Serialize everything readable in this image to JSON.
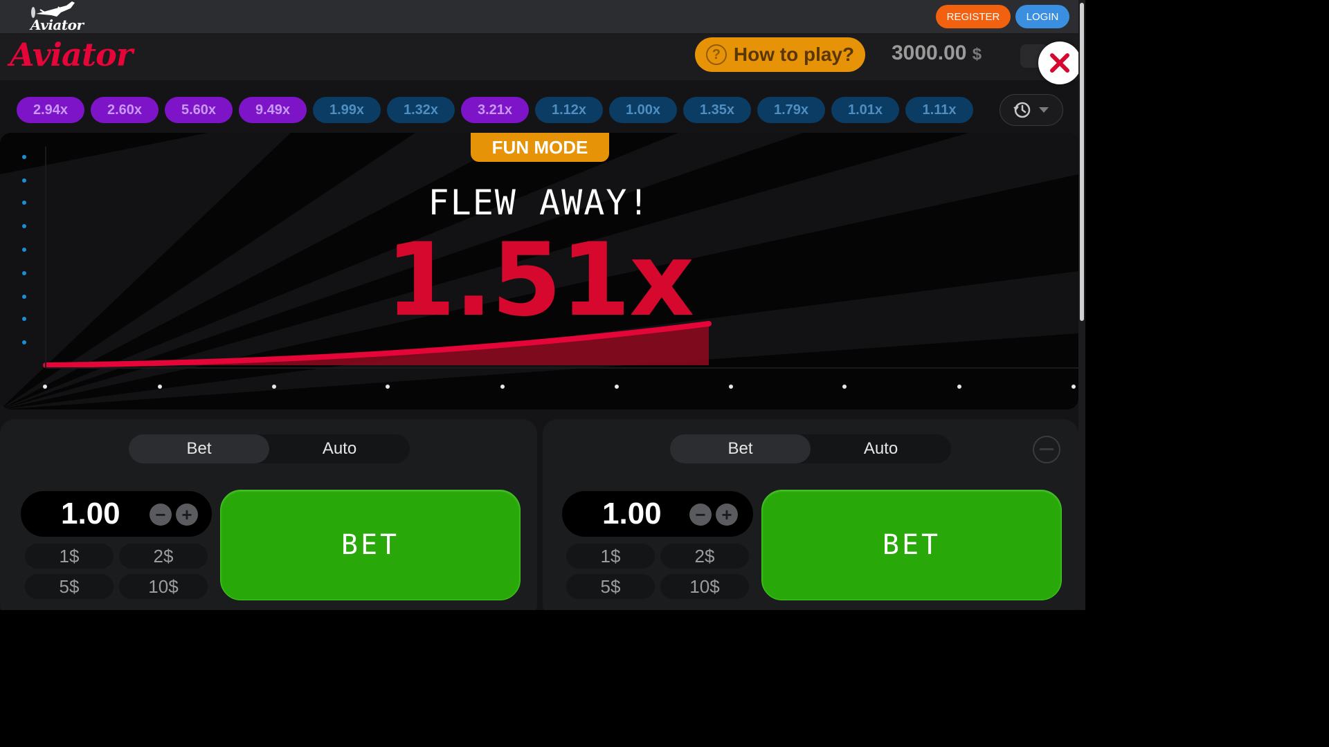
{
  "site_header": {
    "logo_text": "Aviator",
    "register_label": "REGISTER",
    "login_label": "LOGIN",
    "colors": {
      "register": "#f2610f",
      "login": "#3b8fe0"
    }
  },
  "game": {
    "title": "Aviator",
    "how_to_play_label": "How to play?",
    "balance_amount": "3000.00",
    "balance_currency": "$",
    "icons": {
      "help": "question-circle-icon",
      "close": "close-x-icon",
      "menu": "menu-icon"
    }
  },
  "history": {
    "multipliers": [
      {
        "value": "2.94x",
        "tone": "purple"
      },
      {
        "value": "2.60x",
        "tone": "purple"
      },
      {
        "value": "5.60x",
        "tone": "purple"
      },
      {
        "value": "9.49x",
        "tone": "purple"
      },
      {
        "value": "1.99x",
        "tone": "blue"
      },
      {
        "value": "1.32x",
        "tone": "blue"
      },
      {
        "value": "3.21x",
        "tone": "purple"
      },
      {
        "value": "1.12x",
        "tone": "blue"
      },
      {
        "value": "1.00x",
        "tone": "blue"
      },
      {
        "value": "1.35x",
        "tone": "blue"
      },
      {
        "value": "1.79x",
        "tone": "blue"
      },
      {
        "value": "1.01x",
        "tone": "blue"
      },
      {
        "value": "1.11x",
        "tone": "blue"
      }
    ],
    "icons": {
      "history": "history-clock-icon",
      "expand": "chevron-down-icon"
    }
  },
  "round": {
    "mode_badge": "FUN MODE",
    "status_text": "FLEW AWAY!",
    "multiplier": "1.51x",
    "crash_color": "#d6082d"
  },
  "bet_panels": [
    {
      "tabs": [
        "Bet",
        "Auto"
      ],
      "active_tab": "Bet",
      "stake": "1.00",
      "quick_amounts": [
        "1$",
        "2$",
        "5$",
        "10$"
      ],
      "bet_label": "BET"
    },
    {
      "tabs": [
        "Bet",
        "Auto"
      ],
      "active_tab": "Bet",
      "stake": "1.00",
      "quick_amounts": [
        "1$",
        "2$",
        "5$",
        "10$"
      ],
      "bet_label": "BET"
    }
  ]
}
